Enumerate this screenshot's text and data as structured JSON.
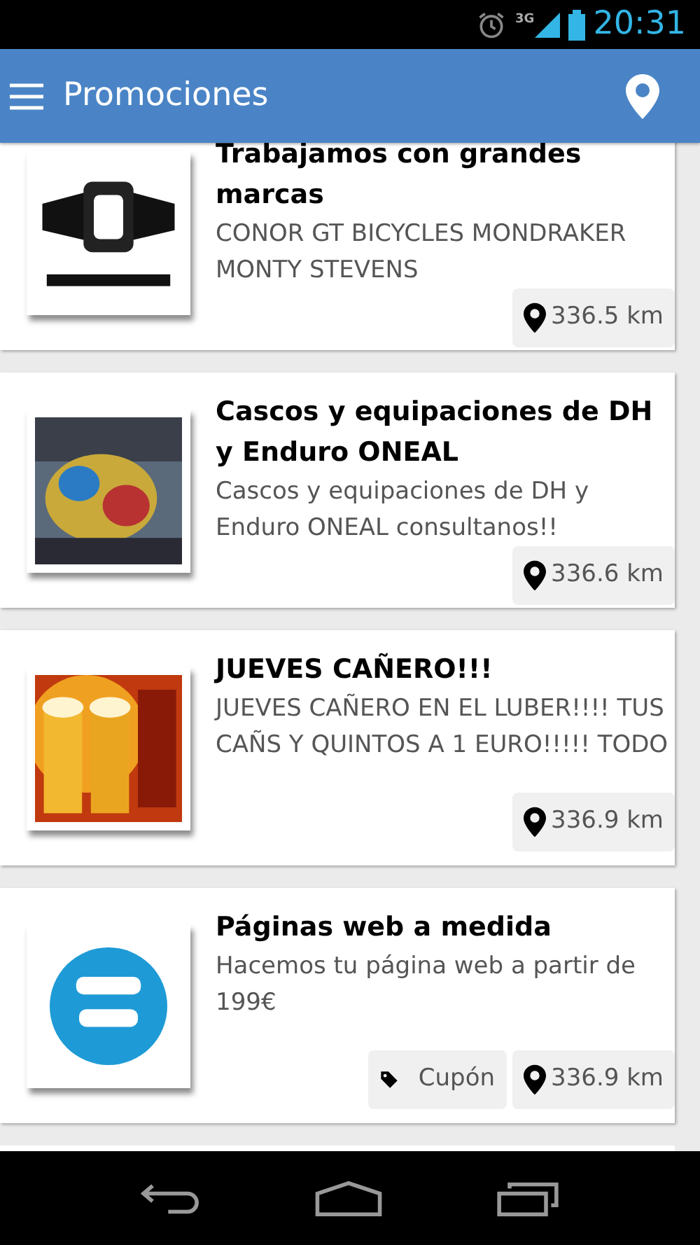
{
  "status_bar": {
    "network": "3G",
    "time": "20:31"
  },
  "app_bar": {
    "title": "Promociones"
  },
  "promotions": [
    {
      "title": "Trabajamos con grandes marcas",
      "description": "CONOR GT BICYCLES MONDRAKER MONTY STEVENS",
      "badges": [
        {
          "kind": "distance",
          "text": "336.5 km"
        }
      ]
    },
    {
      "title": "Cascos y equipaciones de DH y Enduro ONEAL",
      "description": "Cascos y equipaciones de DH y Enduro ONEAL consultanos!!",
      "badges": [
        {
          "kind": "distance",
          "text": "336.6 km"
        }
      ]
    },
    {
      "title": "JUEVES CAÑERO!!!",
      "description": "JUEVES CAÑERO EN EL LUBER!!!! TUS CAÑS Y QUINTOS A 1 EURO!!!!! TODO",
      "badges": [
        {
          "kind": "distance",
          "text": "336.9 km"
        }
      ]
    },
    {
      "title": "Páginas web a medida",
      "description": "Hacemos tu página web a partir de 199€",
      "badges": [
        {
          "kind": "coupon",
          "text": "Cupón"
        },
        {
          "kind": "distance",
          "text": "336.9 km"
        }
      ]
    }
  ]
}
